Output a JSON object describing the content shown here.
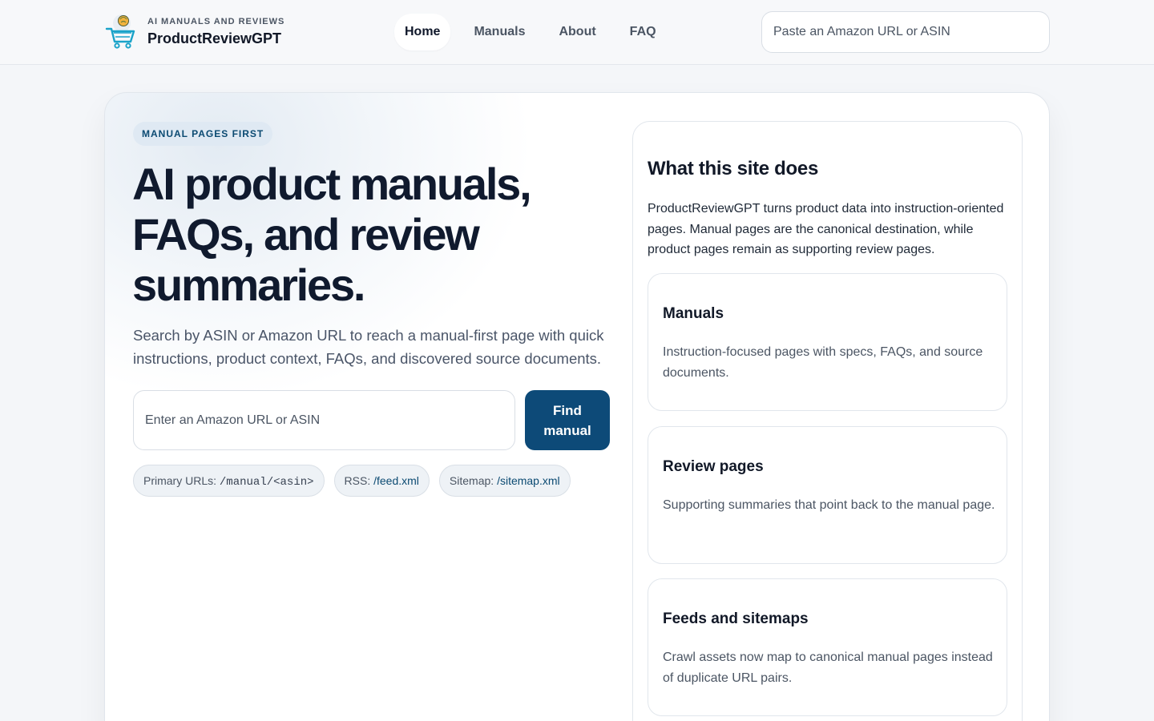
{
  "brand": {
    "eyebrow": "AI MANUALS AND REVIEWS",
    "name": "ProductReviewGPT",
    "logo_icon": "shopping-cart-logo-icon"
  },
  "nav": {
    "items": [
      {
        "label": "Home",
        "active": true
      },
      {
        "label": "Manuals",
        "active": false
      },
      {
        "label": "About",
        "active": false
      },
      {
        "label": "FAQ",
        "active": false
      }
    ]
  },
  "header_search": {
    "placeholder": "Paste an Amazon URL or ASIN",
    "value": ""
  },
  "hero": {
    "eyebrow": "MANUAL PAGES FIRST",
    "title": "AI product manuals, FAQs, and review summaries.",
    "lead": "Search by ASIN or Amazon URL to reach a manual-first page with quick instructions, product context, FAQs, and discovered source documents.",
    "search": {
      "placeholder": "Enter an Amazon URL or ASIN",
      "value": ""
    },
    "find_button": "Find manual",
    "chips": [
      {
        "label": "Primary URLs: ",
        "code": "/manual/<asin>"
      },
      {
        "label": "RSS: ",
        "link": "/feed.xml"
      },
      {
        "label": "Sitemap: ",
        "link": "/sitemap.xml"
      }
    ]
  },
  "info_panel": {
    "title": "What this site does",
    "description": "ProductReviewGPT turns product data into instruction-oriented pages. Manual pages are the canonical destination, while product pages remain as supporting review pages.",
    "features": [
      {
        "title": "Manuals",
        "description": "Instruction-focused pages with specs, FAQs, and source documents."
      },
      {
        "title": "Review pages",
        "description": "Supporting summaries that point back to the manual page."
      },
      {
        "title": "Feeds and sitemaps",
        "description": "Crawl assets now map to canonical manual pages instead of duplicate URL pairs."
      }
    ]
  },
  "colors": {
    "accent": "#0d4a78",
    "eyebrow_bg": "#dfe9f3",
    "page_bg": "#f4f6f9",
    "text_dark": "#101a2e",
    "text_muted": "#4b5563"
  }
}
